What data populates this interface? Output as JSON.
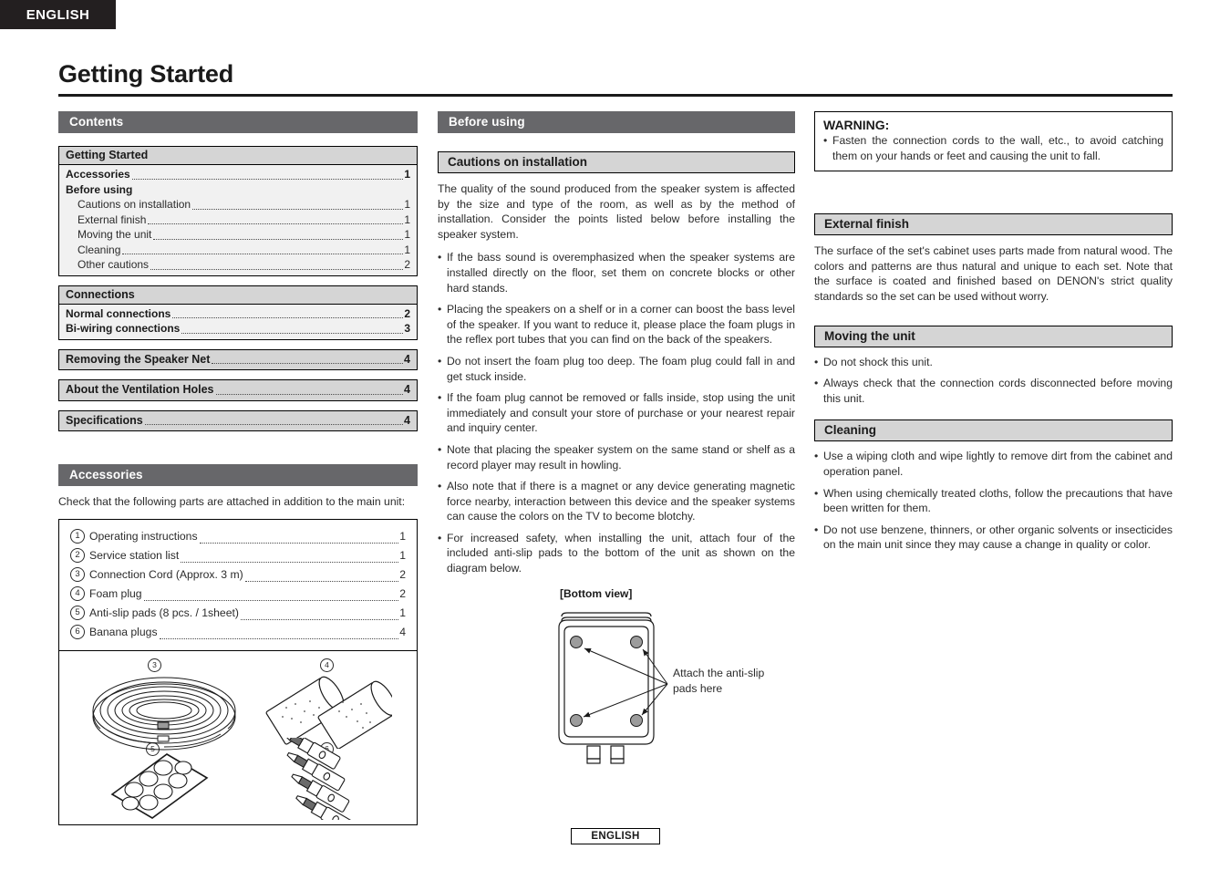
{
  "language_tab": "ENGLISH",
  "page_title": "Getting Started",
  "footer_language": "ENGLISH",
  "colors": {
    "band_dark": "#67676a",
    "band_light": "#d5d5d5",
    "tab_dark": "#231f20",
    "toc_body": "#f1f1f1"
  },
  "contents": {
    "heading": "Contents",
    "groups": [
      {
        "title": "Getting Started",
        "rows": [
          {
            "label": "Accessories",
            "page": "1",
            "style": "bold",
            "leader": true
          },
          {
            "label": "Before using",
            "page": "",
            "style": "bold",
            "leader": false
          },
          {
            "label": "Cautions on installation",
            "page": "1",
            "style": "indent",
            "leader": true
          },
          {
            "label": "External finish",
            "page": "1",
            "style": "indent",
            "leader": true
          },
          {
            "label": "Moving the unit",
            "page": "1",
            "style": "indent",
            "leader": true
          },
          {
            "label": "Cleaning",
            "page": "1",
            "style": "indent",
            "leader": true
          },
          {
            "label": "Other cautions",
            "page": "2",
            "style": "indent",
            "leader": true
          }
        ]
      },
      {
        "title": "Connections",
        "rows": [
          {
            "label": "Normal connections",
            "page": "2",
            "style": "bold",
            "leader": true
          },
          {
            "label": "Bi-wiring connections",
            "page": "3",
            "style": "bold",
            "leader": true
          }
        ]
      }
    ],
    "singles": [
      {
        "label": "Removing the Speaker Net",
        "page": "4"
      },
      {
        "label": "About the Ventilation Holes",
        "page": "4"
      },
      {
        "label": "Specifications",
        "page": "4"
      }
    ]
  },
  "accessories": {
    "heading": "Accessories",
    "intro": "Check that the following parts are attached in addition to the main unit:",
    "items": [
      {
        "num": "1",
        "label": "Operating instructions",
        "qty": "1"
      },
      {
        "num": "2",
        "label": "Service station list",
        "qty": "1"
      },
      {
        "num": "3",
        "label": "Connection Cord (Approx. 3 m)",
        "qty": "2"
      },
      {
        "num": "4",
        "label": "Foam plug",
        "qty": "2"
      },
      {
        "num": "5",
        "label": "Anti-slip pads (8 pcs. / 1sheet)",
        "qty": "1"
      },
      {
        "num": "6",
        "label": "Banana plugs",
        "qty": "4"
      }
    ],
    "figure_captions": [
      "3",
      "4",
      "5",
      "6"
    ]
  },
  "before_using": {
    "heading": "Before using",
    "cautions": {
      "heading": "Cautions on installation",
      "intro": "The quality of the sound produced from the speaker system is affected by the size and type of the room, as well as by the method of installation. Consider the points listed below before installing the speaker system.",
      "bullets": [
        "If the bass sound is overemphasized when the speaker systems are installed directly on the floor, set them on concrete blocks or other hard stands.",
        "Placing the speakers on a shelf or in a corner can boost the bass level of the speaker. If you want to reduce it, please place the foam plugs in the reflex port tubes that you can find on the back of the speakers.",
        "Do not insert the foam plug too deep. The foam plug could fall in and get stuck inside.",
        "If the foam plug cannot be removed or falls inside, stop using the unit immediately and consult your store of purchase or your nearest repair and inquiry center.",
        "Note that placing the speaker system on the same stand or shelf as a record player may result in howling.",
        "Also note that if there is a magnet or any device generating magnetic force nearby, interaction between this device and the speaker systems can cause the colors on the TV to become blotchy.",
        "For increased safety, when installing the unit, attach four of the included anti-slip pads to the bottom of the unit as shown on the diagram below."
      ]
    },
    "diagram": {
      "label": "[Bottom view]",
      "callout": "Attach the anti-slip pads here"
    }
  },
  "warning": {
    "title": "WARNING:",
    "text": "Fasten the connection cords to the wall, etc., to avoid catching them on your hands or feet and causing the unit to fall."
  },
  "external_finish": {
    "heading": "External finish",
    "text": "The surface of the set's cabinet uses parts made from natural wood. The colors and patterns are thus natural and unique to each set. Note that the surface is coated and finished based on DENON's strict quality standards so the set can be used without worry."
  },
  "moving_the_unit": {
    "heading": "Moving the unit",
    "bullets": [
      "Do not shock this unit.",
      "Always check that the connection cords disconnected before moving this unit."
    ]
  },
  "cleaning": {
    "heading": "Cleaning",
    "bullets": [
      "Use a wiping cloth and wipe lightly to remove dirt from the cabinet and operation panel.",
      "When using chemically treated cloths, follow the precautions that have been written for them.",
      "Do not use benzene, thinners, or other organic solvents or insecticides on the main unit since they may cause a change in quality or color."
    ]
  }
}
